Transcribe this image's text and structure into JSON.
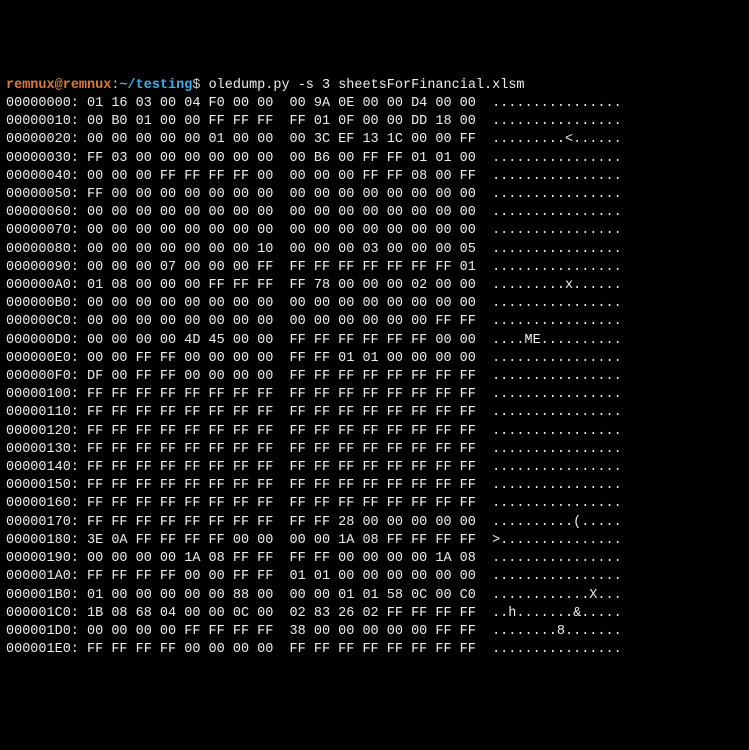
{
  "prompt": {
    "user": "remnux",
    "at": "@",
    "host": "remnux",
    "sep": ":",
    "path": "~/testing",
    "dollar": "$"
  },
  "command": "oledump.py -s 3 sheetsForFinancial.xlsm",
  "hex_rows": [
    {
      "off": "00000000:",
      "h1": "01 16 03 00 04 F0 00 00",
      "h2": "00 9A 0E 00 00 D4 00 00",
      "a": "................"
    },
    {
      "off": "00000010:",
      "h1": "00 B0 01 00 00 FF FF FF",
      "h2": "FF 01 0F 00 00 DD 18 00",
      "a": "................"
    },
    {
      "off": "00000020:",
      "h1": "00 00 00 00 00 01 00 00",
      "h2": "00 3C EF 13 1C 00 00 FF",
      "a": ".........<......"
    },
    {
      "off": "00000030:",
      "h1": "FF 03 00 00 00 00 00 00",
      "h2": "00 B6 00 FF FF 01 01 00",
      "a": "................"
    },
    {
      "off": "00000040:",
      "h1": "00 00 00 FF FF FF FF 00",
      "h2": "00 00 00 FF FF 08 00 FF",
      "a": "................"
    },
    {
      "off": "00000050:",
      "h1": "FF 00 00 00 00 00 00 00",
      "h2": "00 00 00 00 00 00 00 00",
      "a": "................"
    },
    {
      "off": "00000060:",
      "h1": "00 00 00 00 00 00 00 00",
      "h2": "00 00 00 00 00 00 00 00",
      "a": "................"
    },
    {
      "off": "00000070:",
      "h1": "00 00 00 00 00 00 00 00",
      "h2": "00 00 00 00 00 00 00 00",
      "a": "................"
    },
    {
      "off": "00000080:",
      "h1": "00 00 00 00 00 00 00 10",
      "h2": "00 00 00 03 00 00 00 05",
      "a": "................"
    },
    {
      "off": "00000090:",
      "h1": "00 00 00 07 00 00 00 FF",
      "h2": "FF FF FF FF FF FF FF 01",
      "a": "................"
    },
    {
      "off": "000000A0:",
      "h1": "01 08 00 00 00 FF FF FF",
      "h2": "FF 78 00 00 00 02 00 00",
      "a": ".........x......"
    },
    {
      "off": "000000B0:",
      "h1": "00 00 00 00 00 00 00 00",
      "h2": "00 00 00 00 00 00 00 00",
      "a": "................"
    },
    {
      "off": "000000C0:",
      "h1": "00 00 00 00 00 00 00 00",
      "h2": "00 00 00 00 00 00 FF FF",
      "a": "................"
    },
    {
      "off": "000000D0:",
      "h1": "00 00 00 00 4D 45 00 00",
      "h2": "FF FF FF FF FF FF 00 00",
      "a": "....ME.........."
    },
    {
      "off": "000000E0:",
      "h1": "00 00 FF FF 00 00 00 00",
      "h2": "FF FF 01 01 00 00 00 00",
      "a": "................"
    },
    {
      "off": "000000F0:",
      "h1": "DF 00 FF FF 00 00 00 00",
      "h2": "FF FF FF FF FF FF FF FF",
      "a": "................"
    },
    {
      "off": "00000100:",
      "h1": "FF FF FF FF FF FF FF FF",
      "h2": "FF FF FF FF FF FF FF FF",
      "a": "................"
    },
    {
      "off": "00000110:",
      "h1": "FF FF FF FF FF FF FF FF",
      "h2": "FF FF FF FF FF FF FF FF",
      "a": "................"
    },
    {
      "off": "00000120:",
      "h1": "FF FF FF FF FF FF FF FF",
      "h2": "FF FF FF FF FF FF FF FF",
      "a": "................"
    },
    {
      "off": "00000130:",
      "h1": "FF FF FF FF FF FF FF FF",
      "h2": "FF FF FF FF FF FF FF FF",
      "a": "................"
    },
    {
      "off": "00000140:",
      "h1": "FF FF FF FF FF FF FF FF",
      "h2": "FF FF FF FF FF FF FF FF",
      "a": "................"
    },
    {
      "off": "00000150:",
      "h1": "FF FF FF FF FF FF FF FF",
      "h2": "FF FF FF FF FF FF FF FF",
      "a": "................"
    },
    {
      "off": "00000160:",
      "h1": "FF FF FF FF FF FF FF FF",
      "h2": "FF FF FF FF FF FF FF FF",
      "a": "................"
    },
    {
      "off": "00000170:",
      "h1": "FF FF FF FF FF FF FF FF",
      "h2": "FF FF 28 00 00 00 00 00",
      "a": "..........(....."
    },
    {
      "off": "00000180:",
      "h1": "3E 0A FF FF FF FF 00 00",
      "h2": "00 00 1A 08 FF FF FF FF",
      "a": ">..............."
    },
    {
      "off": "00000190:",
      "h1": "00 00 00 00 1A 08 FF FF",
      "h2": "FF FF 00 00 00 00 1A 08",
      "a": "................"
    },
    {
      "off": "000001A0:",
      "h1": "FF FF FF FF 00 00 FF FF",
      "h2": "01 01 00 00 00 00 00 00",
      "a": "................"
    },
    {
      "off": "000001B0:",
      "h1": "01 00 00 00 00 00 88 00",
      "h2": "00 00 01 01 58 0C 00 C0",
      "a": "............X..."
    },
    {
      "off": "000001C0:",
      "h1": "1B 08 68 04 00 00 0C 00",
      "h2": "02 83 26 02 FF FF FF FF",
      "a": "..h.......&....."
    },
    {
      "off": "000001D0:",
      "h1": "00 00 00 00 FF FF FF FF",
      "h2": "38 00 00 00 00 00 FF FF",
      "a": "........8......."
    },
    {
      "off": "000001E0:",
      "h1": "FF FF FF FF 00 00 00 00",
      "h2": "FF FF FF FF FF FF FF FF",
      "a": "................"
    }
  ]
}
